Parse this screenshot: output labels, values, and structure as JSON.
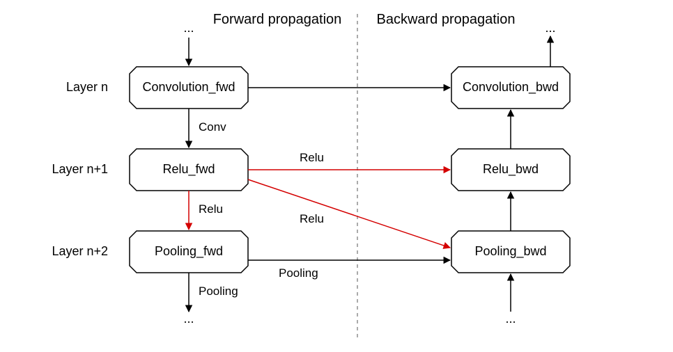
{
  "headers": {
    "forward": "Forward propagation",
    "backward": "Backward propagation"
  },
  "layers": {
    "l1": "Layer n",
    "l2": "Layer n+1",
    "l3": "Layer n+2"
  },
  "nodes": {
    "fwd_conv": "Convolution_fwd",
    "fwd_relu": "Relu_fwd",
    "fwd_pool": "Pooling_fwd",
    "bwd_conv": "Convolution_bwd",
    "bwd_relu": "Relu_bwd",
    "bwd_pool": "Pooling_bwd"
  },
  "edge_labels": {
    "fwd_conv_down": "Conv",
    "fwd_relu_down": "Relu",
    "fwd_pool_down": "Pooling",
    "cross_relu_to_bwdrelu": "Relu",
    "cross_relu_to_bwdpool": "Relu",
    "cross_pool_to_bwdpool": "Pooling"
  },
  "dots": "...",
  "colors": {
    "black": "#000000",
    "red": "#d40000"
  }
}
